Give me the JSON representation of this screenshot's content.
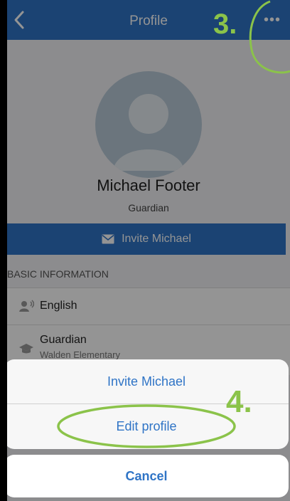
{
  "navbar": {
    "back_icon": "chevron-left-icon",
    "title": "Profile",
    "more_icon": "more-horizontal-icon"
  },
  "profile": {
    "name": "Michael Footer",
    "role": "Guardian",
    "invite_button_label": "Invite Michael",
    "invite_icon": "mail-icon"
  },
  "basic_info": {
    "header": "BASIC INFORMATION",
    "rows": [
      {
        "icon": "speaking-icon",
        "primary": "English",
        "secondary": ""
      },
      {
        "icon": "graduation-cap-icon",
        "primary": "Guardian",
        "secondary": "Walden Elementary"
      }
    ]
  },
  "action_sheet": {
    "items": [
      {
        "label": "Invite Michael"
      },
      {
        "label": "Edit profile"
      }
    ],
    "cancel_label": "Cancel"
  },
  "annotations": {
    "step_3": "3.",
    "step_4": "4.",
    "accent_color": "#8bc34a"
  },
  "colors": {
    "brand_blue": "#2f74c6"
  }
}
